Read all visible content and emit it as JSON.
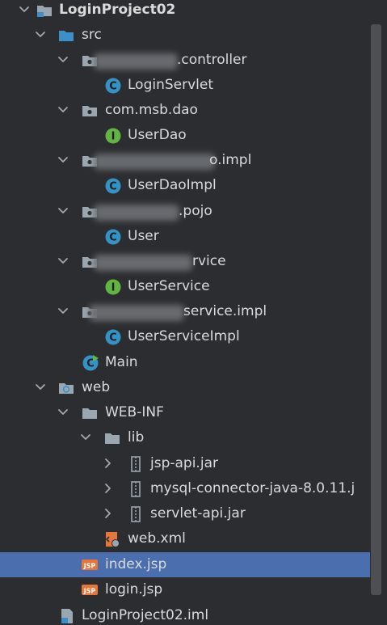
{
  "tree": {
    "project": {
      "name": "LoginProject02"
    },
    "src": {
      "name": "src"
    },
    "packages": [
      {
        "name_suffix": ".controller",
        "children": [
          {
            "name": "LoginServlet",
            "kind": "class"
          }
        ]
      },
      {
        "name": "com.msb.dao",
        "children": [
          {
            "name": "UserDao",
            "kind": "interface"
          }
        ]
      },
      {
        "name_suffix": "o.impl",
        "children": [
          {
            "name": "UserDaoImpl",
            "kind": "class"
          }
        ]
      },
      {
        "name_suffix": ".pojo",
        "children": [
          {
            "name": "User",
            "kind": "class"
          }
        ]
      },
      {
        "name_suffix": "rvice",
        "children": [
          {
            "name": "UserService",
            "kind": "interface"
          }
        ]
      },
      {
        "name_suffix": "service.impl",
        "children": [
          {
            "name": "UserServiceImpl",
            "kind": "class"
          }
        ]
      }
    ],
    "main": {
      "name": "Main"
    },
    "web": {
      "name": "web"
    },
    "webinf": {
      "name": "WEB-INF"
    },
    "lib": {
      "name": "lib"
    },
    "jars": [
      {
        "name": "jsp-api.jar"
      },
      {
        "name": "mysql-connector-java-8.0.11.j"
      },
      {
        "name": "servlet-api.jar"
      }
    ],
    "webxml": {
      "name": "web.xml"
    },
    "indexjsp": {
      "name": "index.jsp"
    },
    "loginjsp": {
      "name": "login.jsp"
    },
    "iml": {
      "name": "LoginProject02.iml"
    }
  },
  "colors": {
    "background": "#2b2d30",
    "selection": "#4b6eaf",
    "text": "#dadada",
    "class_icon": "#3592c4",
    "interface_icon": "#62b543",
    "folder_icon": "#9aa7b0",
    "jsp_icon": "#e8763a"
  }
}
